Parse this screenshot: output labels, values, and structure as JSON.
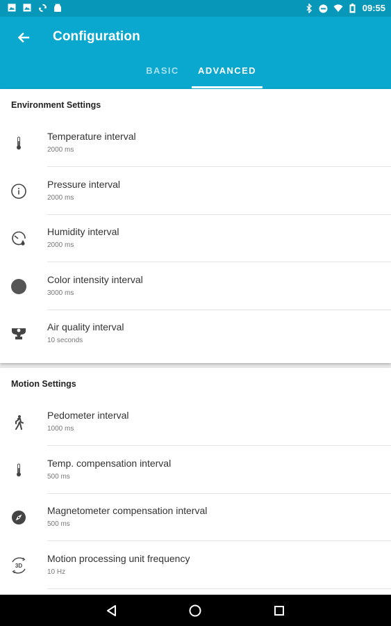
{
  "status_bar": {
    "time": "09:55",
    "left_icons": [
      "image-icon",
      "image-icon",
      "sync-icon",
      "android-icon"
    ],
    "right_icons": [
      "bluetooth-icon",
      "do-not-disturb-icon",
      "wifi-icon",
      "battery-icon"
    ]
  },
  "app_bar": {
    "title": "Configuration",
    "back_icon": "arrow-back-icon",
    "tabs": [
      {
        "label": "BASIC",
        "selected": false
      },
      {
        "label": "ADVANCED",
        "selected": true
      }
    ]
  },
  "environment": {
    "heading": "Environment Settings",
    "items": [
      {
        "label": "Temperature interval",
        "value": "2000 ms",
        "icon": "thermometer-icon"
      },
      {
        "label": "Pressure interval",
        "value": "2000 ms",
        "icon": "pressure-gauge-icon"
      },
      {
        "label": "Humidity interval",
        "value": "2000 ms",
        "icon": "humidity-icon"
      },
      {
        "label": "Color intensity interval",
        "value": "3000 ms",
        "icon": "color-circle-icon"
      },
      {
        "label": "Air quality interval",
        "value": "10 seconds",
        "icon": "air-quality-icon"
      }
    ]
  },
  "motion": {
    "heading": "Motion Settings",
    "items": [
      {
        "label": "Pedometer interval",
        "value": "1000 ms",
        "icon": "walking-person-icon"
      },
      {
        "label": "Temp. compensation interval",
        "value": "500 ms",
        "icon": "thermometer-icon"
      },
      {
        "label": "Magnetometer compensation interval",
        "value": "500 ms",
        "icon": "compass-icon"
      },
      {
        "label": "Motion processing unit frequency",
        "value": "10 Hz",
        "icon": "rotate-3d-icon"
      }
    ]
  },
  "nav_bar": {
    "buttons": [
      "back-triangle-icon",
      "home-circle-icon",
      "recents-square-icon"
    ]
  },
  "colors": {
    "status_bar": "#0797b8",
    "app_bar": "#0aa8cf",
    "tab_inactive": "#a8e0ee",
    "background": "#ececec"
  }
}
